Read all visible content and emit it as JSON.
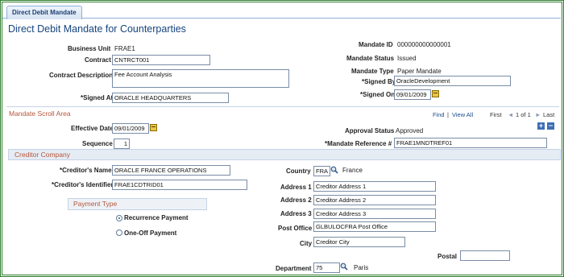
{
  "tab": {
    "label": "Direct Debit Mandate"
  },
  "page_title": "Direct Debit Mandate for Counterparties",
  "header": {
    "business_unit_label": "Business Unit",
    "business_unit": "FRAE1",
    "contract_label": "Contract",
    "contract": "CNTRCT001",
    "contract_desc_label": "Contract Description",
    "contract_desc": "Fee Account Analysis",
    "signed_at_label": "*Signed At",
    "signed_at": "ORACLE HEADQUARTERS",
    "mandate_id_label": "Mandate ID",
    "mandate_id": "000000000000001",
    "mandate_status_label": "Mandate Status",
    "mandate_status": "Issued",
    "mandate_type_label": "Mandate Type",
    "mandate_type": "Paper Mandate",
    "signed_by_label": "*Signed By",
    "signed_by": "OracleDevelopment",
    "signed_on_label": "*Signed On",
    "signed_on": "09/01/2009"
  },
  "scroll": {
    "title": "Mandate Scroll Area",
    "find": "Find",
    "sep": "|",
    "view_all": "View All",
    "first": "First",
    "prev_icon": "◄",
    "range": "1 of 1",
    "next_icon": "►",
    "last": "Last",
    "effective_date_label": "Effective Date",
    "effective_date": "09/01/2009",
    "sequence_label": "Sequence",
    "sequence": "1",
    "approval_status_label": "Approval Status",
    "approval_status": "Approved",
    "mandate_ref_label": "*Mandate Reference #",
    "mandate_ref": "FRAE1MNDTREF01",
    "add_row": "+",
    "delete_row": "−"
  },
  "creditor": {
    "title": "Creditor Company",
    "name_label": "*Creditor's Name",
    "name": "ORACLE FRANCE OPERATIONS",
    "identifier_label": "*Creditor's Identifier",
    "identifier": "FRAE1CDTRID01",
    "payment_type_title": "Payment Type",
    "recurrence_label": "Recurrence Payment",
    "oneoff_label": "One-Off Payment",
    "recurrence_selected": true,
    "country_label": "Country",
    "country": "FRA",
    "country_name": "France",
    "address1_label": "Address 1",
    "address1": "Creditor Address 1",
    "address2_label": "Address 2",
    "address2": "Creditor Address 2",
    "address3_label": "Address 3",
    "address3": "Creditor Address 3",
    "post_office_label": "Post Office",
    "post_office": "GLBULOCFRA Post Office",
    "city_label": "City",
    "city": "Creditor City",
    "postal_label": "Postal",
    "postal": "",
    "department_label": "Department",
    "department": "75",
    "department_name": "Paris"
  },
  "colors": {
    "accent": "#17447e",
    "section": "#b5553a",
    "frame": "#2f7d2f"
  }
}
